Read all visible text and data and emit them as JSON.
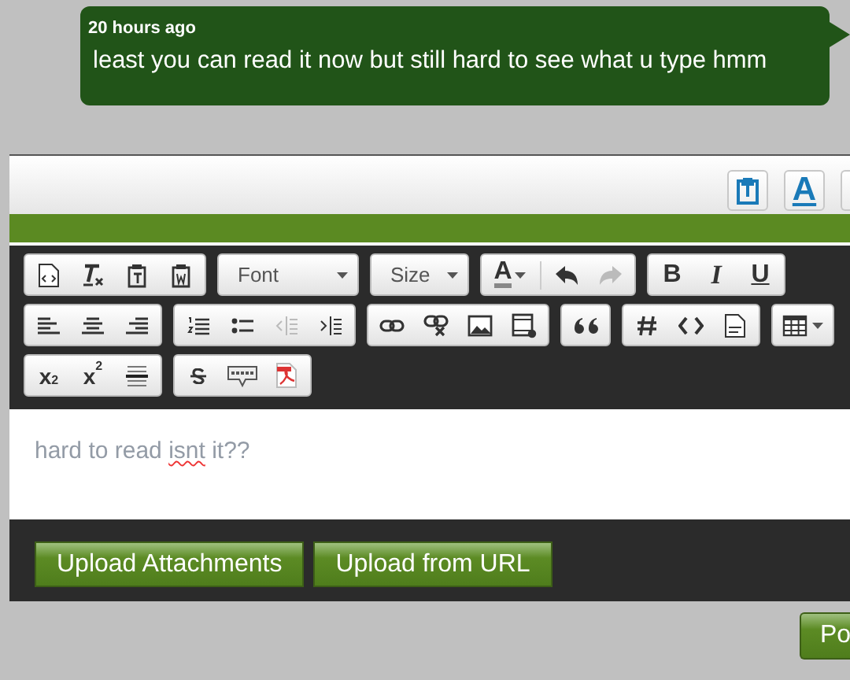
{
  "message": {
    "time": "20 hours ago",
    "text": "least you can read it now but still hard to see what u type hmm"
  },
  "editor_header": {
    "font_button": "A"
  },
  "toolbar": {
    "font_dropdown": "Font",
    "size_dropdown": "Size",
    "font_color": "A",
    "undo": {
      "disabled": false
    },
    "redo": {
      "disabled": true
    },
    "outdent": {
      "disabled": true
    },
    "indent": {
      "disabled": false
    },
    "format_buttons": [
      {
        "kind": "bold",
        "label": "B"
      },
      {
        "kind": "italic",
        "label": "I"
      },
      {
        "kind": "underline",
        "label": "U"
      }
    ],
    "script_buttons": [
      "x$_{2}$",
      "x$^{2}$"
    ]
  },
  "editor": {
    "text_before": "hard to read ",
    "misspelled": "isnt",
    "text_after": " it??"
  },
  "upload_buttons": [
    "Upload Attachments",
    "Upload from URL"
  ],
  "post_button": "Po"
}
